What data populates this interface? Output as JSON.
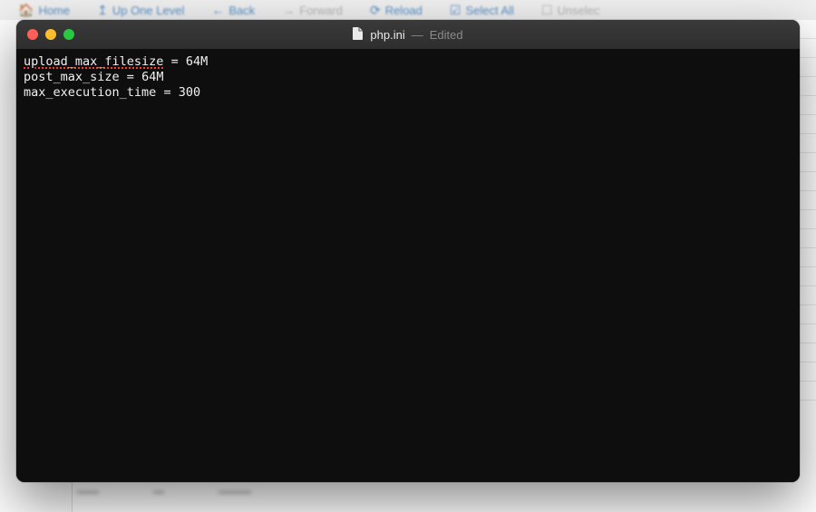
{
  "toolbar": {
    "home": "Home",
    "up": "Up One Level",
    "back": "Back",
    "forward": "Forward",
    "reload": "Reload",
    "selectAll": "Select All",
    "unselect": "Unselec"
  },
  "window": {
    "filename": "php.ini",
    "separator": "—",
    "status": "Edited"
  },
  "editor": {
    "lines": [
      {
        "key": "upload_max_filesize",
        "sep": " = ",
        "value": "64M",
        "spellErrorOnKey": true
      },
      {
        "key": "post_max_size",
        "sep": " = ",
        "value": "64M",
        "spellErrorOnKey": false
      },
      {
        "key": "max_execution_time",
        "sep": " = ",
        "value": "300",
        "spellErrorOnKey": false
      }
    ]
  }
}
